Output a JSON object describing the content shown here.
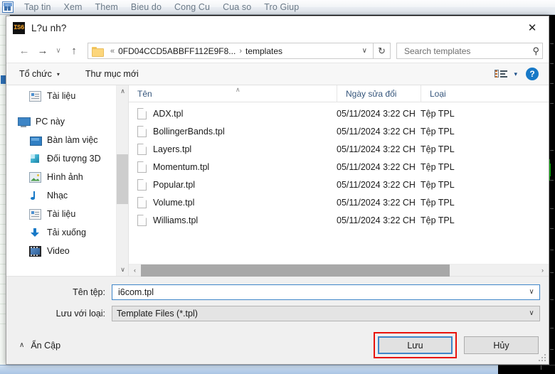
{
  "platform": {
    "app_icon": "mt-app-icon",
    "menu": [
      {
        "label": "Tap tin"
      },
      {
        "label": "Xem"
      },
      {
        "label": "Them"
      },
      {
        "label": "Bieu do"
      },
      {
        "label": "Cong Cu"
      },
      {
        "label": "Cua so"
      },
      {
        "label": "Tro Giup"
      }
    ]
  },
  "dialog": {
    "title": "L?u nh?",
    "icon_text": "IS6",
    "close_label": "✕",
    "nav": {
      "back": "←",
      "forward": "→",
      "recent": "∨",
      "up": "↑",
      "breadcrumb": {
        "root": "0FD04CCD5ABBFF112E9F8...",
        "separator_leading": "«",
        "separator": "›",
        "current": "templates",
        "dropdown_caret": "∨"
      },
      "refresh": "↻",
      "search": {
        "placeholder": "Search templates",
        "value": "",
        "icon": "search-icon"
      }
    },
    "command_bar": {
      "organize": "Tổ chức",
      "organize_caret": "▾",
      "new_folder": "Thư mục mới",
      "view_caret": "▾",
      "help": "?"
    },
    "sidebar": {
      "items": [
        {
          "label": "Tài liệu",
          "icon": "document-icon",
          "level": 1
        },
        {
          "label": "PC này",
          "icon": "computer-icon",
          "level": 0
        },
        {
          "label": "Bàn làm việc",
          "icon": "desktop-icon",
          "level": 1
        },
        {
          "label": "Đối tượng 3D",
          "icon": "3d-objects-icon",
          "level": 1
        },
        {
          "label": "Hình ảnh",
          "icon": "pictures-icon",
          "level": 1
        },
        {
          "label": "Nhạc",
          "icon": "music-icon",
          "level": 1
        },
        {
          "label": "Tài liệu",
          "icon": "document-icon",
          "level": 1
        },
        {
          "label": "Tải xuống",
          "icon": "downloads-icon",
          "level": 1
        },
        {
          "label": "Video",
          "icon": "video-icon",
          "level": 1
        }
      ],
      "scroll_up": "∧",
      "scroll_down": "∨"
    },
    "file_list": {
      "columns": [
        "Tên",
        "Ngày sửa đổi",
        "Loại"
      ],
      "sort_indicator": "∧",
      "rows": [
        {
          "name": "ADX.tpl",
          "date": "05/11/2024 3:22 CH",
          "type": "Tệp TPL"
        },
        {
          "name": "BollingerBands.tpl",
          "date": "05/11/2024 3:22 CH",
          "type": "Tệp TPL"
        },
        {
          "name": "Layers.tpl",
          "date": "05/11/2024 3:22 CH",
          "type": "Tệp TPL"
        },
        {
          "name": "Momentum.tpl",
          "date": "05/11/2024 3:22 CH",
          "type": "Tệp TPL"
        },
        {
          "name": "Popular.tpl",
          "date": "05/11/2024 3:22 CH",
          "type": "Tệp TPL"
        },
        {
          "name": "Volume.tpl",
          "date": "05/11/2024 3:22 CH",
          "type": "Tệp TPL"
        },
        {
          "name": "Williams.tpl",
          "date": "05/11/2024 3:22 CH",
          "type": "Tệp TPL"
        }
      ],
      "hscroll_left": "‹",
      "hscroll_right": "›"
    },
    "fields": {
      "filename_label": "Tên tệp:",
      "filename_value": "i6com.tpl",
      "filetype_label": "Lưu với loại:",
      "filetype_value": "Template Files (*.tpl)",
      "caret": "∨"
    },
    "footer": {
      "hide_folders": "Ẩn Cập",
      "hide_folders_caret": "∧",
      "save_label": "Lưu",
      "cancel_label": "Hủy"
    }
  },
  "colors": {
    "accent_blue": "#3f86c9",
    "highlight_red": "#e8120c",
    "column_header_text": "#36567c",
    "title_icon_orange": "#f0a028",
    "candle_green": "#14b814"
  }
}
